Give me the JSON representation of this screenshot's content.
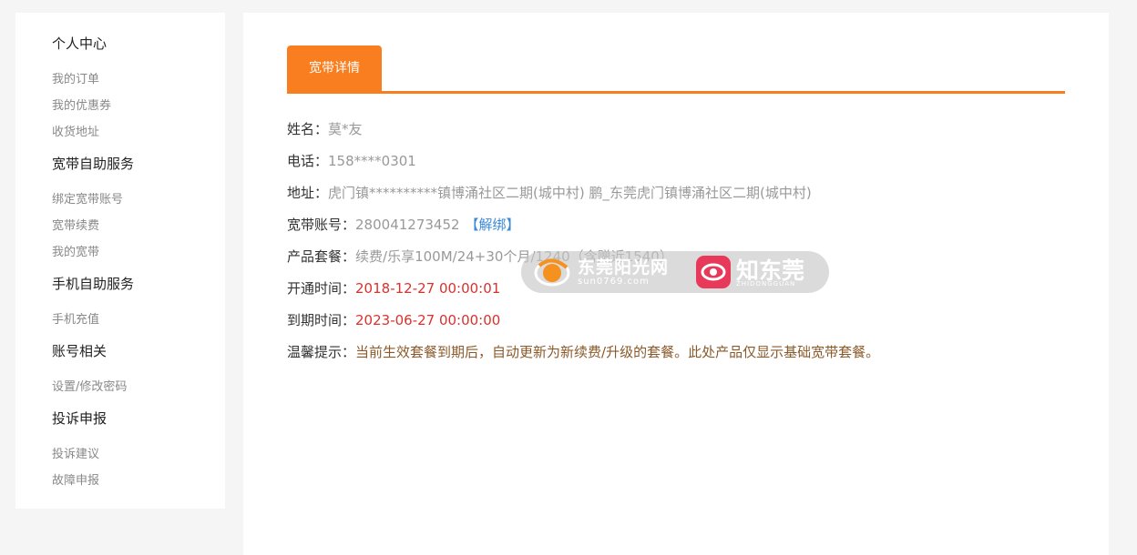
{
  "sidebar": {
    "groups": [
      {
        "title": "个人中心",
        "items": [
          "我的订单",
          "我的优惠券",
          "收货地址"
        ]
      },
      {
        "title": "宽带自助服务",
        "items": [
          "绑定宽带账号",
          "宽带续费",
          "我的宽带"
        ]
      },
      {
        "title": "手机自助服务",
        "items": [
          "手机充值"
        ]
      },
      {
        "title": "账号相关",
        "items": [
          "设置/修改密码"
        ]
      },
      {
        "title": "投诉申报",
        "items": [
          "投诉建议",
          "故障申报"
        ]
      }
    ]
  },
  "main": {
    "tab_label": "宽带详情",
    "fields": {
      "name": {
        "label": "姓名：",
        "value": "莫*友"
      },
      "phone": {
        "label": "电话：",
        "value": "158****0301"
      },
      "address": {
        "label": "地址：",
        "value": "虎门镇**********镇博涌社区二期(城中村) 鹏_东莞虎门镇博涌社区二期(城中村)"
      },
      "account": {
        "label": "宽带账号：",
        "value": "280041273452",
        "action": "【解绑】"
      },
      "package": {
        "label": "产品套餐：",
        "value": "续费/乐享100M/24+30个月/1240（含赠近1540）"
      },
      "start": {
        "label": "开通时间：",
        "value": "2018-12-27 00:00:01"
      },
      "expire": {
        "label": "到期时间：",
        "value": "2023-06-27 00:00:00"
      },
      "tip": {
        "label": "温馨提示：",
        "value": "当前生效套餐到期后，自动更新为新续费/升级的套餐。此处产品仅显示基础宽带套餐。"
      }
    }
  },
  "watermark": {
    "site1_name": "东莞阳光网",
    "site1_url": "sun0769.com",
    "site2_name": "知东莞",
    "site2_sub": "ZHIDONGGUAN"
  },
  "colors": {
    "accent": "#f97e1f",
    "date_red": "#d9322d",
    "link_blue": "#3a8ad8",
    "tip_brown": "#8b5a2b"
  }
}
